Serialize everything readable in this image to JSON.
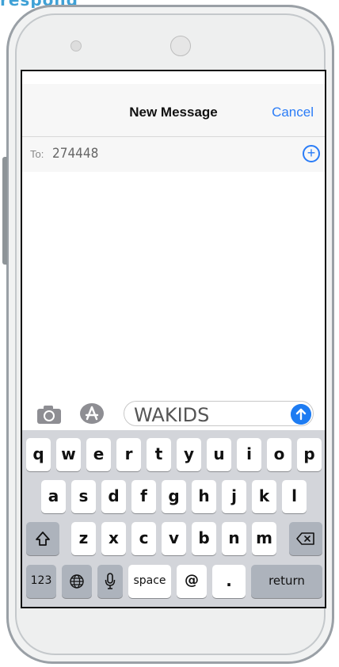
{
  "nav": {
    "title": "New Message",
    "cancel_label": "Cancel"
  },
  "recipient": {
    "label": "To:",
    "value": "274448"
  },
  "composer": {
    "message_text": "WAKIDS"
  },
  "keyboard": {
    "row1": [
      "q",
      "w",
      "e",
      "r",
      "t",
      "y",
      "u",
      "i",
      "o",
      "p"
    ],
    "row2": [
      "a",
      "s",
      "d",
      "f",
      "g",
      "h",
      "j",
      "k",
      "l"
    ],
    "row3": [
      "z",
      "x",
      "c",
      "v",
      "b",
      "n",
      "m"
    ],
    "numbers_label": "123",
    "space_label": "space",
    "at_label": "@",
    "dot_label": ".",
    "return_label": "return"
  },
  "colors": {
    "accent": "#2a7cf7",
    "send_button": "#1e7cf2",
    "keyboard_bg": "#d3d5da",
    "function_key": "#adb3bc"
  },
  "icons": {
    "shift": "shift-icon",
    "backspace": "backspace-icon",
    "globe": "globe-icon",
    "mic": "microphone-icon",
    "camera": "camera-icon",
    "app_store": "app-store-icon",
    "send": "send-arrow-icon",
    "add": "add-contact-icon"
  }
}
